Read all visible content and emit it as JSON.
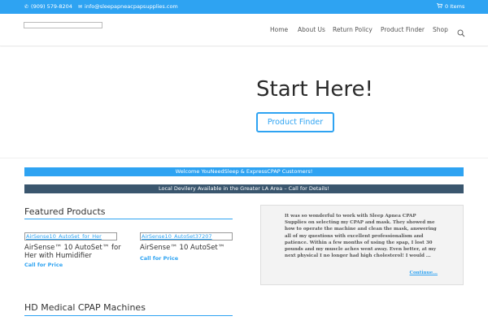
{
  "topbar": {
    "phone": "(909) 579-8204",
    "email": "info@sleepapneacpapsupplies.com",
    "cart": "0 Items"
  },
  "nav": {
    "items": [
      "Home",
      "About Us",
      "Return Policy",
      "Product Finder",
      "Shop"
    ]
  },
  "hero": {
    "title": "Start Here!",
    "button": "Product Finder"
  },
  "banners": {
    "welcome": "Welcome YouNeedSleep & ExpressCPAP Customers!",
    "delivery": "Local Devilery Available in the Greater LA Area – Call for Details!"
  },
  "featured": {
    "title": "Featured Products",
    "products": [
      {
        "image_alt": "AirSense10_AutoSet_for_Her",
        "name": "AirSense™ 10 AutoSet™ for Her with Humidifier",
        "price": "Call for Price"
      },
      {
        "image_alt": "AirSense10_AutoSet37207",
        "name": "AirSense™ 10 AutoSet™",
        "price": "Call for Price"
      }
    ]
  },
  "testimonial": {
    "text": "It was so wonderful to work with Sleep Apnea CPAP Supplies on selecting my CPAP and mask.  They showed me how to operate the machine and clean the mask, answering all of my questions with excellent professionalism and patience. Within a few months of using the spap, I lost 30 pounds and my muscle aches went away.  Even better, at my next physical I no longer had high cholesterol! I would ...",
    "more": "Continue..."
  },
  "section2": {
    "title": "HD Medical CPAP Machines"
  },
  "colors": {
    "accent": "#2ea3f2",
    "dark_banner": "#3a566e"
  }
}
